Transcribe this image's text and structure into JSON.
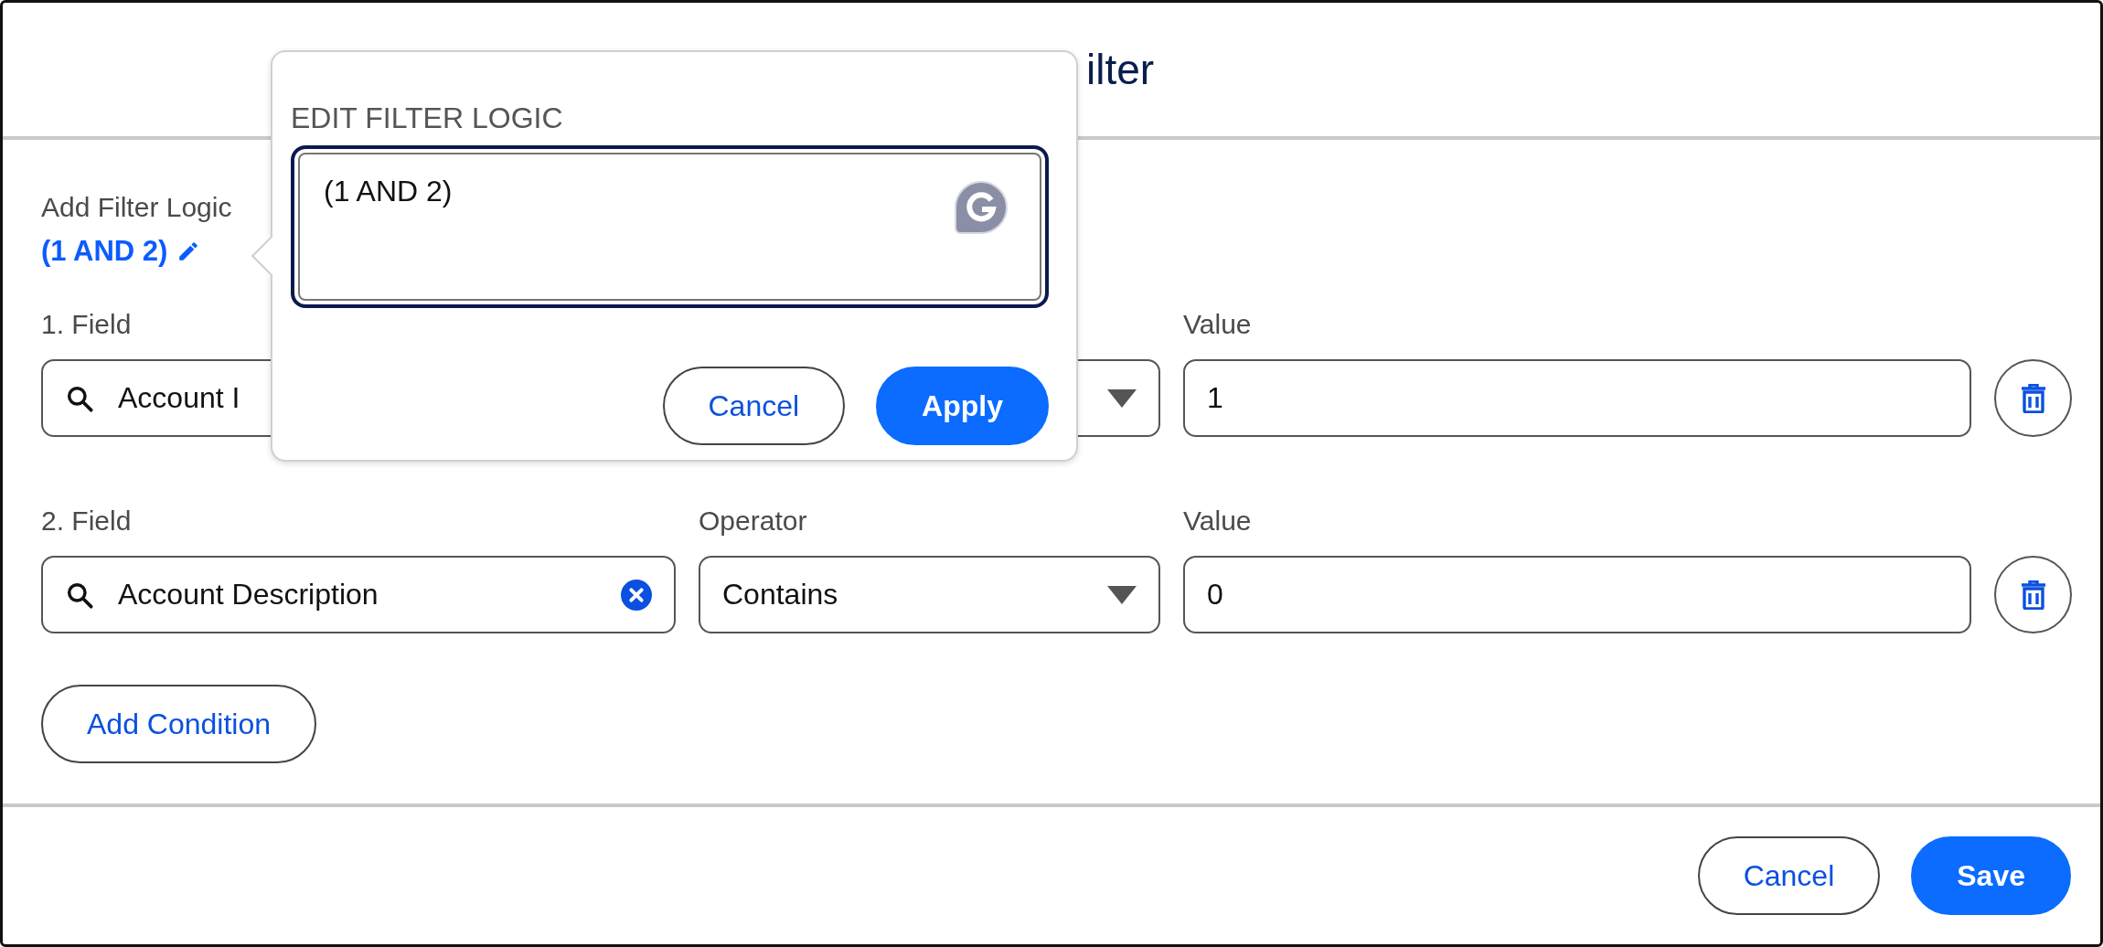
{
  "window": {
    "title": "ilter"
  },
  "filter_logic": {
    "label": "Add Filter Logic",
    "value": "(1 AND 2)"
  },
  "conditions": [
    {
      "field_label": "1. Field",
      "field": "Account I",
      "value_label": "Value",
      "value": "1"
    },
    {
      "field_label": "2. Field",
      "field": "Account Description",
      "operator_label": "Operator",
      "operator": "Contains",
      "value_label": "Value",
      "value": "0"
    }
  ],
  "add_condition": "Add Condition",
  "popover": {
    "heading": "EDIT FILTER LOGIC",
    "text": "(1 AND 2)",
    "buttons": [
      {
        "label": "Cancel",
        "kind": "secondary"
      },
      {
        "label": "Apply",
        "kind": "primary"
      }
    ]
  },
  "footer": {
    "buttons": [
      {
        "label": "Cancel",
        "kind": "secondary"
      },
      {
        "label": "Save",
        "kind": "primary"
      }
    ]
  }
}
